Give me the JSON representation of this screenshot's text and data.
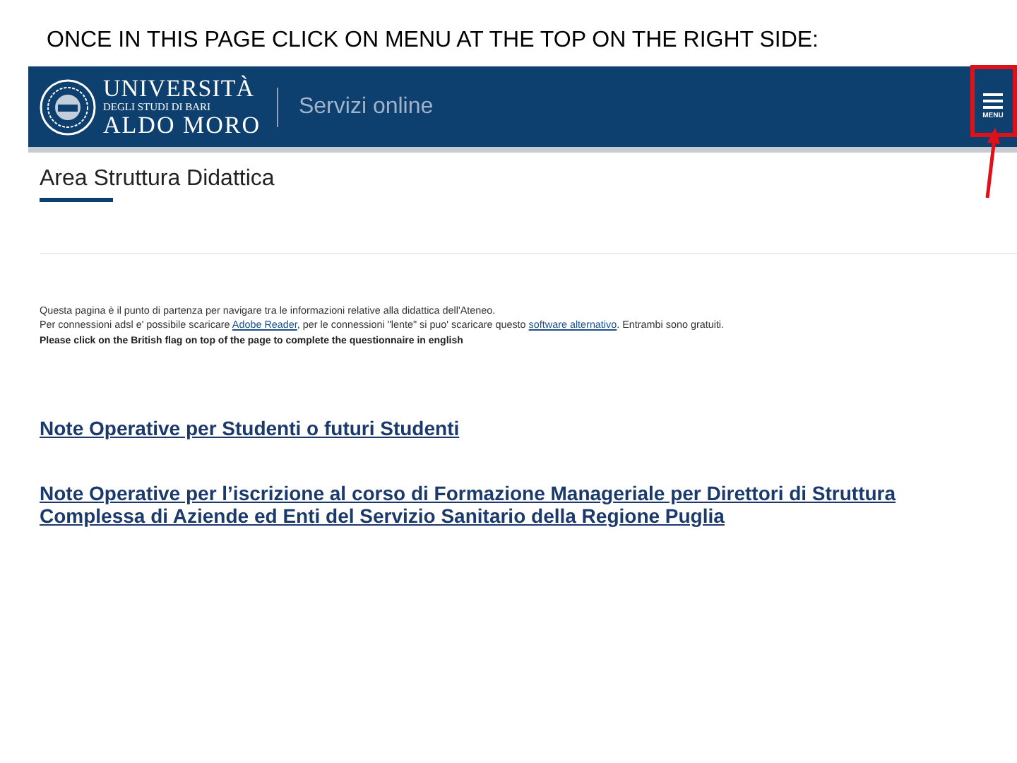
{
  "caption": "ONCE IN THIS PAGE CLICK ON MENU AT THE TOP ON THE RIGHT SIDE:",
  "header": {
    "logo_lines": [
      "UNIVERSITÀ",
      "DEGLI STUDI DI BARI",
      "ALDO MORO"
    ],
    "service": "Servizi online",
    "menu_label": "MENU",
    "menu_highlighted": true
  },
  "page_title": "Area Struttura Didattica",
  "intro": [
    [
      {
        "kind": "text",
        "text": "Questa pagina è il punto di partenza per navigare tra le informazioni relative alla didattica dell'Ateneo."
      }
    ],
    [
      {
        "kind": "text",
        "text": "Per connessioni adsl e' possibile scaricare "
      },
      {
        "kind": "link",
        "text": "Adobe Reader"
      },
      {
        "kind": "text",
        "text": ", per le connessioni \"lente\" si puo' scaricare questo "
      },
      {
        "kind": "link",
        "text": "software alternativo"
      },
      {
        "kind": "text",
        "text": ". Entrambi sono gratuiti."
      }
    ]
  ],
  "notice": "Please click on the British flag on top of the page to complete the questionnaire in english",
  "links": [
    "Note Operative per Studenti o futuri Studenti",
    "Note Operative per l’iscrizione al corso di Formazione Manageriale per Direttori di Struttura Complessa di Aziende ed Enti del Servizio Sanitario della Regione Puglia"
  ]
}
